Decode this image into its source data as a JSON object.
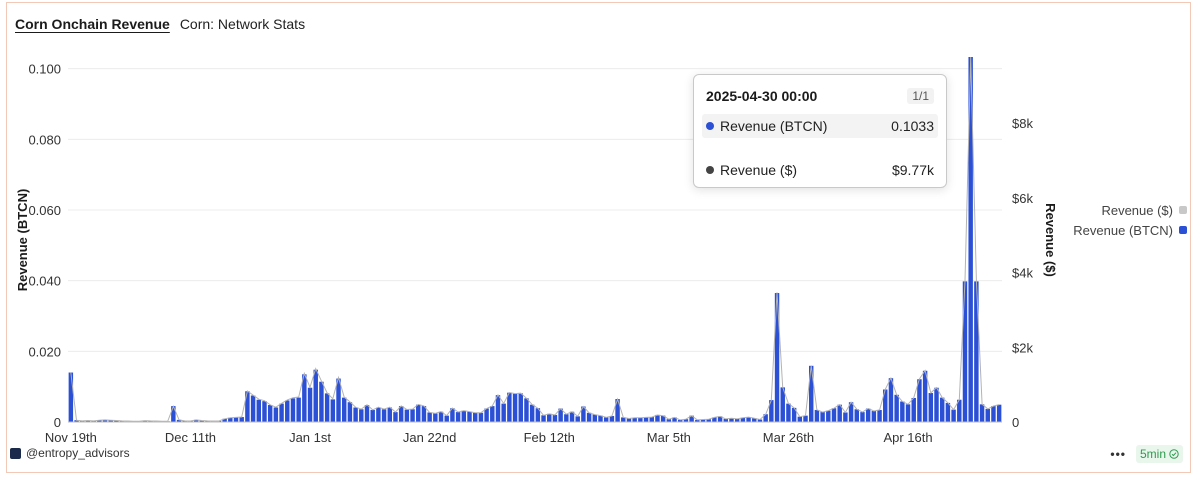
{
  "header": {
    "title": "Corn Onchain Revenue",
    "subtitle": "Corn: Network Stats"
  },
  "tooltip": {
    "date": "2025-04-30 00:00",
    "page": "1/1",
    "rows": [
      {
        "label": "Revenue (BTCN)",
        "value": "0.1033",
        "color": "#2b50d6"
      },
      {
        "label": "Revenue ($)",
        "value": "$9.77k",
        "color": "#444444"
      }
    ]
  },
  "legend": [
    {
      "label": "Revenue ($)",
      "color": "#c8c8c8"
    },
    {
      "label": "Revenue (BTCN)",
      "color": "#2b50d6"
    }
  ],
  "footer": {
    "handle": "@entropy_advisors",
    "refresh": "5min"
  },
  "colors": {
    "bar": "#2b50d6",
    "line": "#b3b3b3",
    "grid": "#ececec"
  },
  "chart_data": {
    "type": "bar",
    "title": "Corn Onchain Revenue",
    "ylabel": "Revenue (BTCN)",
    "y2label": "Revenue ($)",
    "ylim": [
      0,
      0.1033
    ],
    "y2lim": [
      0,
      9770
    ],
    "yticks": [
      "0",
      "0.020",
      "0.040",
      "0.060",
      "0.080",
      "0.100"
    ],
    "y2ticks": [
      "0",
      "$2k",
      "$4k",
      "$6k",
      "$8k"
    ],
    "xticks": [
      "Nov 19th",
      "Dec 11th",
      "Jan 1st",
      "Jan 22nd",
      "Feb 12th",
      "Mar 5th",
      "Mar 26th",
      "Apr 16th"
    ],
    "start_date": "2024-11-19",
    "grid": true,
    "legend_position": "right",
    "series": [
      {
        "name": "Revenue (BTCN)",
        "values": [
          0.014,
          0.0005,
          0.0003,
          0.0004,
          0.0003,
          0.0005,
          0.0006,
          0.0005,
          0.0004,
          0.0003,
          0.0003,
          0.0002,
          0.0002,
          0.0004,
          0.0003,
          0.0003,
          0.0002,
          0.0002,
          0.0045,
          0.0006,
          0.0003,
          0.0003,
          0.0006,
          0.0004,
          0.0003,
          0.0003,
          0.0003,
          0.0009,
          0.0012,
          0.0013,
          0.0014,
          0.0087,
          0.0075,
          0.0063,
          0.0059,
          0.0048,
          0.0041,
          0.0052,
          0.0061,
          0.0067,
          0.0069,
          0.0135,
          0.0097,
          0.0148,
          0.0114,
          0.0081,
          0.0064,
          0.0123,
          0.0069,
          0.0056,
          0.0041,
          0.0036,
          0.0048,
          0.0034,
          0.0041,
          0.0036,
          0.0041,
          0.0028,
          0.0045,
          0.0035,
          0.0036,
          0.0049,
          0.0045,
          0.0027,
          0.0024,
          0.0029,
          0.0018,
          0.0039,
          0.0028,
          0.0032,
          0.0029,
          0.0026,
          0.0026,
          0.0038,
          0.0045,
          0.0076,
          0.0052,
          0.0083,
          0.008,
          0.0081,
          0.0067,
          0.0049,
          0.0039,
          0.0019,
          0.0023,
          0.002,
          0.0038,
          0.0022,
          0.0029,
          0.0016,
          0.0044,
          0.0026,
          0.0021,
          0.0018,
          0.0013,
          0.0017,
          0.0065,
          0.0013,
          0.001,
          0.0012,
          0.0012,
          0.0013,
          0.0014,
          0.002,
          0.0018,
          0.0008,
          0.0013,
          0.0006,
          0.0008,
          0.0018,
          0.0006,
          0.0007,
          0.0008,
          0.0013,
          0.0016,
          0.0009,
          0.0011,
          0.0009,
          0.0012,
          0.0014,
          0.0011,
          0.0007,
          0.0022,
          0.0062,
          0.0365,
          0.0098,
          0.0052,
          0.004,
          0.0015,
          0.0018,
          0.0159,
          0.0034,
          0.0028,
          0.0032,
          0.0039,
          0.0049,
          0.0027,
          0.0056,
          0.0036,
          0.0028,
          0.0038,
          0.0031,
          0.0034,
          0.0092,
          0.0124,
          0.0077,
          0.0058,
          0.005,
          0.0068,
          0.0121,
          0.0145,
          0.0082,
          0.0097,
          0.0069,
          0.0054,
          0.0035,
          0.0063,
          0.0398,
          0.1033,
          0.0398,
          0.005,
          0.0037,
          0.0045,
          0.0049
        ]
      },
      {
        "name": "Revenue ($)",
        "values": [
          1330,
          45,
          30,
          40,
          30,
          48,
          55,
          48,
          40,
          30,
          28,
          20,
          20,
          38,
          30,
          28,
          20,
          20,
          420,
          55,
          30,
          28,
          56,
          40,
          30,
          28,
          28,
          85,
          115,
          124,
          135,
          830,
          720,
          610,
          570,
          460,
          395,
          500,
          590,
          650,
          670,
          1300,
          930,
          1430,
          1100,
          780,
          620,
          1190,
          665,
          540,
          395,
          345,
          460,
          325,
          395,
          345,
          395,
          268,
          430,
          335,
          345,
          470,
          430,
          258,
          230,
          278,
          172,
          372,
          268,
          305,
          278,
          248,
          248,
          362,
          428,
          725,
          495,
          790,
          760,
          770,
          635,
          465,
          370,
          180,
          218,
          190,
          360,
          208,
          275,
          152,
          415,
          245,
          198,
          170,
          122,
          160,
          612,
          122,
          94,
          112,
          112,
          122,
          132,
          188,
          168,
          75,
          122,
          56,
          75,
          168,
          56,
          66,
          75,
          122,
          150,
          84,
          103,
          84,
          112,
          131,
          103,
          66,
          206,
          582,
          3470,
          930,
          494,
          380,
          142,
          171,
          1510,
          323,
          266,
          304,
          370,
          465,
          256,
          532,
          342,
          266,
          361,
          294,
          323,
          874,
          1178,
          731,
          551,
          475,
          646,
          1150,
          1378,
          779,
          921,
          655,
          513,
          332,
          598,
          3780,
          9770,
          3780,
          475,
          351,
          427,
          465
        ]
      }
    ]
  }
}
